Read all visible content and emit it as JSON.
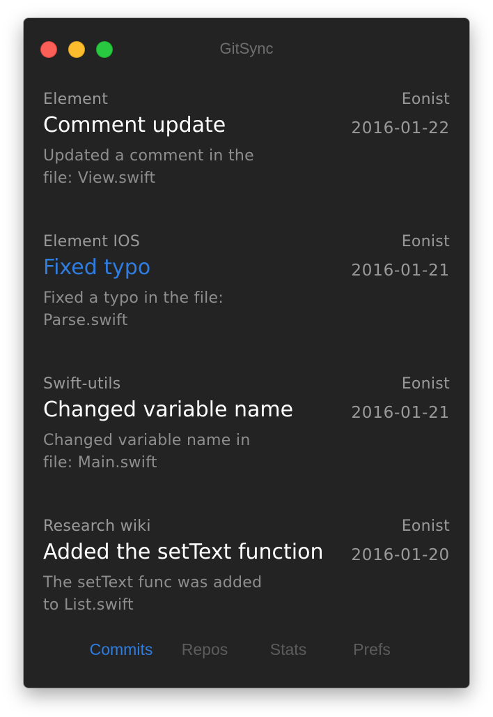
{
  "window": {
    "title": "GitSync"
  },
  "commits": [
    {
      "repo": "Element",
      "author": "Eonist",
      "title": "Comment update",
      "date": "2016-01-22",
      "description": "Updated a comment in the file: View.swift",
      "selected": false
    },
    {
      "repo": "Element IOS",
      "author": "Eonist",
      "title": "Fixed typo",
      "date": "2016-01-21",
      "description": "Fixed a typo in the file: Parse.swift",
      "selected": true
    },
    {
      "repo": "Swift-utils",
      "author": "Eonist",
      "title": "Changed variable name",
      "date": "2016-01-21",
      "description": "Changed variable name in file: Main.swift",
      "selected": false
    },
    {
      "repo": "Research wiki",
      "author": "Eonist",
      "title": "Added the setText function",
      "date": "2016-01-20",
      "description": "The setText func was added to List.swift",
      "selected": false
    }
  ],
  "tabs": [
    {
      "label": "Commits",
      "active": true
    },
    {
      "label": "Repos",
      "active": false
    },
    {
      "label": "Stats",
      "active": false
    },
    {
      "label": "Prefs",
      "active": false
    }
  ],
  "colors": {
    "window_background": "#232323",
    "accent": "#2f7de1",
    "close_button": "#fc5f57",
    "minimize_button": "#fdbc2e",
    "zoom_button": "#28c940"
  }
}
